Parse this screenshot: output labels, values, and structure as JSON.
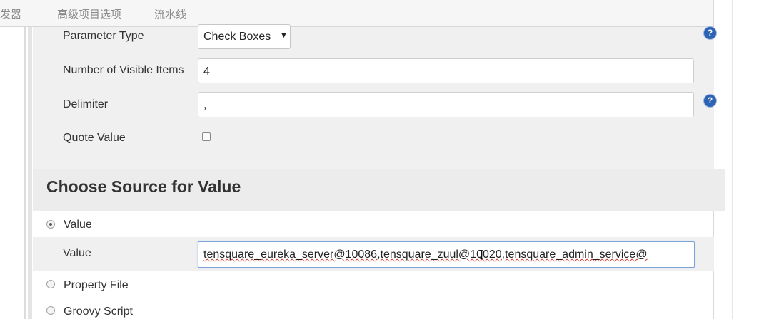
{
  "tabs": [
    "触发器",
    "高级项目选项",
    "流水线"
  ],
  "fields": {
    "parameter_type": {
      "label": "Parameter Type",
      "value": "Check Boxes"
    },
    "visible_items": {
      "label": "Number of Visible Items",
      "value": "4"
    },
    "delimiter": {
      "label": "Delimiter",
      "value": ","
    },
    "quote_value": {
      "label": "Quote Value",
      "checked": false
    }
  },
  "section": {
    "title": "Choose Source for Value"
  },
  "sources": {
    "value_option": "Value",
    "value_label": "Value",
    "value_text": "tensquare_eureka_server@10086,tensquare_zuul@10020,tensquare_admin_service@",
    "property_file": "Property File",
    "groovy_script": "Groovy Script"
  },
  "glyphs": {
    "help": "?",
    "caret": "▼",
    "ibeam": "I"
  }
}
